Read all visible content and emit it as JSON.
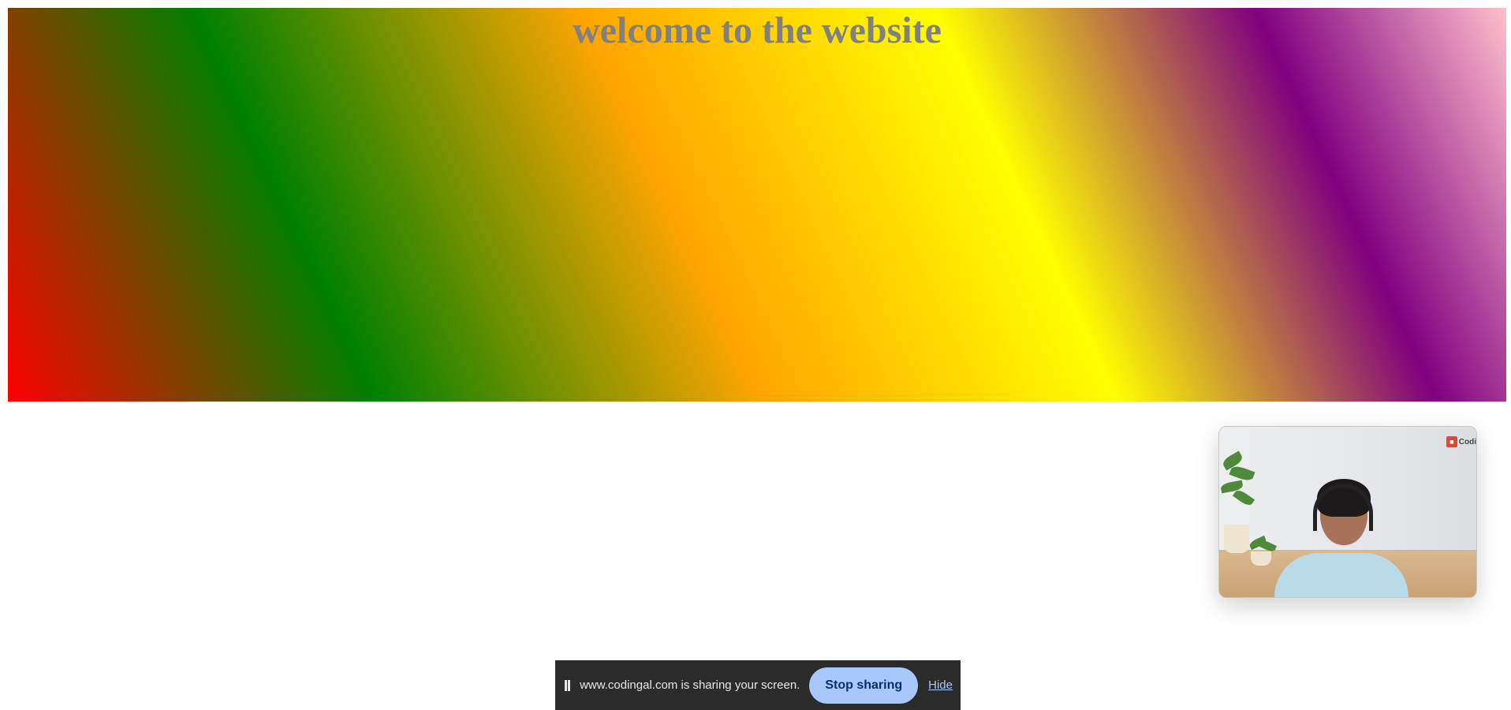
{
  "page": {
    "heading": "welcome to the website",
    "heading_color": "#808080",
    "gradient_colors": [
      "#ff0000",
      "#008000",
      "#ffa500",
      "#ffff00",
      "#800080",
      "#ffc0cb"
    ]
  },
  "video_overlay": {
    "brand_label": "Codi"
  },
  "share_bar": {
    "message": "www.codingal.com is sharing your screen.",
    "stop_label": "Stop sharing",
    "hide_label": "Hide",
    "button_color": "#a8c7fa",
    "bar_color": "#2b2b2b"
  }
}
